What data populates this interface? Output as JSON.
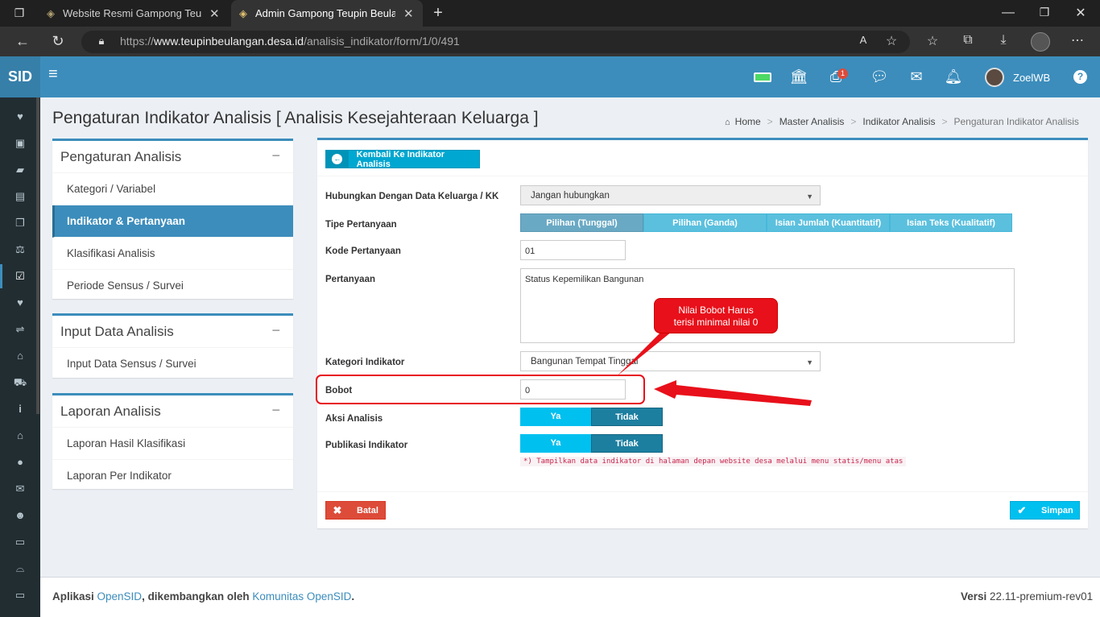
{
  "browser": {
    "tab1_title": "Website Resmi Gampong Teupin",
    "tab2_title": "Admin Gampong Teupin Beulang",
    "url_prefix": "https://",
    "url_domain": "www.teupinbeulangan.desa.id",
    "url_path": "/analisis_indikator/form/1/0/491"
  },
  "header": {
    "brand": "SID",
    "notification_count": "1",
    "user_name": "ZoelWB"
  },
  "page": {
    "title": "Pengaturan Indikator Analisis [ Analisis Kesejahteraan Keluarga ]",
    "breadcrumb": [
      "Home",
      "Master Analisis",
      "Indikator Analisis",
      "Pengaturan Indikator Analisis"
    ]
  },
  "panels": {
    "pengaturan": {
      "title": "Pengaturan Analisis",
      "items": [
        "Kategori / Variabel",
        "Indikator & Pertanyaan",
        "Klasifikasi Analisis",
        "Periode Sensus / Survei"
      ]
    },
    "input": {
      "title": "Input Data Analisis",
      "items": [
        "Input Data Sensus / Survei"
      ]
    },
    "laporan": {
      "title": "Laporan Analisis",
      "items": [
        "Laporan Hasil Klasifikasi",
        "Laporan Per Indikator"
      ]
    }
  },
  "form": {
    "back_label": "Kembali Ke Indikator Analisis",
    "hubungkan_label": "Hubungkan Dengan Data Keluarga / KK",
    "hubungkan_value": "Jangan hubungkan",
    "tipe_label": "Tipe Pertanyaan",
    "tipe_options": [
      "Pilihan (Tunggal)",
      "Pilihan (Ganda)",
      "Isian Jumlah (Kuantitatif)",
      "Isian Teks (Kualitatif)"
    ],
    "kode_label": "Kode Pertanyaan",
    "kode_value": "01",
    "pertanyaan_label": "Pertanyaan",
    "pertanyaan_value": "Status Kepemilikan Bangunan",
    "kategori_label": "Kategori Indikator",
    "kategori_value": "Bangunan Tempat Tinggal",
    "bobot_label": "Bobot",
    "bobot_value": "0",
    "aksi_label": "Aksi Analisis",
    "publikasi_label": "Publikasi Indikator",
    "yes": "Ya",
    "no": "Tidak",
    "note": "*) Tampilkan data indikator di halaman depan website desa melalui menu statis/menu atas",
    "cancel": "Batal",
    "save": "Simpan"
  },
  "callout": {
    "line1": "Nilai Bobot Harus",
    "line2": "terisi minimal nilai 0"
  },
  "footer": {
    "prefix": "Aplikasi ",
    "app": "OpenSID",
    "middle": ", dikembangkan oleh ",
    "community": "Komunitas OpenSID",
    "end": ".",
    "version_label": "Versi",
    "version": "22.11-premium-rev01"
  },
  "colors": {
    "primary": "#3c8dbc",
    "info": "#5bc0de",
    "callout": "#e8101a",
    "danger": "#dd4b39"
  }
}
